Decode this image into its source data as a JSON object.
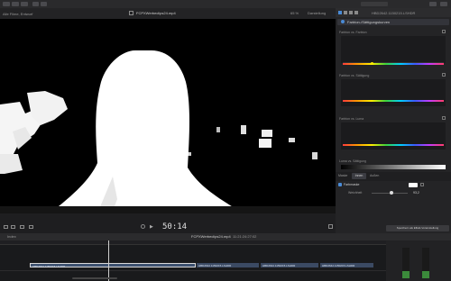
{
  "topbar": {
    "library_label": "Alle Filme, Entwurf"
  },
  "viewer": {
    "filename": "FCPXWerbeclips24.mp4",
    "zoom": "65 %",
    "display_label": "Darstellung",
    "timecode": "50:14"
  },
  "inspector": {
    "clip_name": "HBD2642.1150215.LSHDR",
    "effect_title": "Farbton-/Sättigungskurven",
    "curves": [
      "Farbton vs. Farbton",
      "Farbton vs. Sättigung",
      "Farbton vs. Luma",
      "Luma vs. Sättigung"
    ],
    "tabs": [
      "Maske",
      "Innen",
      "Außen"
    ],
    "mask_label": "Farbmaske",
    "weichheit_label": "Weichheit",
    "weichheit_value": "93,2",
    "save_preset": "Speichern als Effekt-Voreinstellung"
  },
  "timeline": {
    "index_label": "Index",
    "project_title": "FCPXWerbeclips24.mp4",
    "duration": "11:21:24:27:02",
    "clips": [
      "HBD2642.1150215.LSHDR",
      "HBD2642.1150215.LSHDR",
      "HBD2642.1150215.LSHDR",
      "HBD2642.1150215.LSHDR"
    ]
  },
  "colors": {
    "accent_blue": "#4a8bd6",
    "panel_bg": "#242426"
  }
}
